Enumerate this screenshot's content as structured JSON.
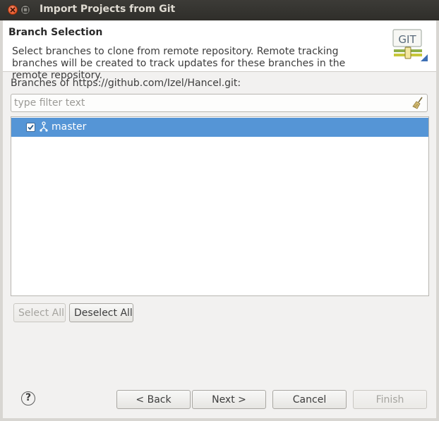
{
  "window": {
    "title": "Import Projects from Git"
  },
  "header": {
    "title": "Branch Selection",
    "description": "Select branches to clone from remote repository. Remote tracking branches will be created to track updates for these branches in the remote repository.",
    "logo_text": "GIT"
  },
  "branches": {
    "label": "Branches of https://github.com/Izel/Hancel.git:",
    "filter_placeholder": "type filter text",
    "items": [
      {
        "label": "master",
        "checked": true
      }
    ]
  },
  "selection_buttons": {
    "select_all": "Select All",
    "deselect_all": "Deselect All"
  },
  "footer": {
    "help": "?",
    "back": "< Back",
    "next": "Next >",
    "cancel": "Cancel",
    "finish": "Finish"
  },
  "colors": {
    "selection": "#5595d6",
    "titlebar": "#3c3b37",
    "close": "#df4a16"
  }
}
